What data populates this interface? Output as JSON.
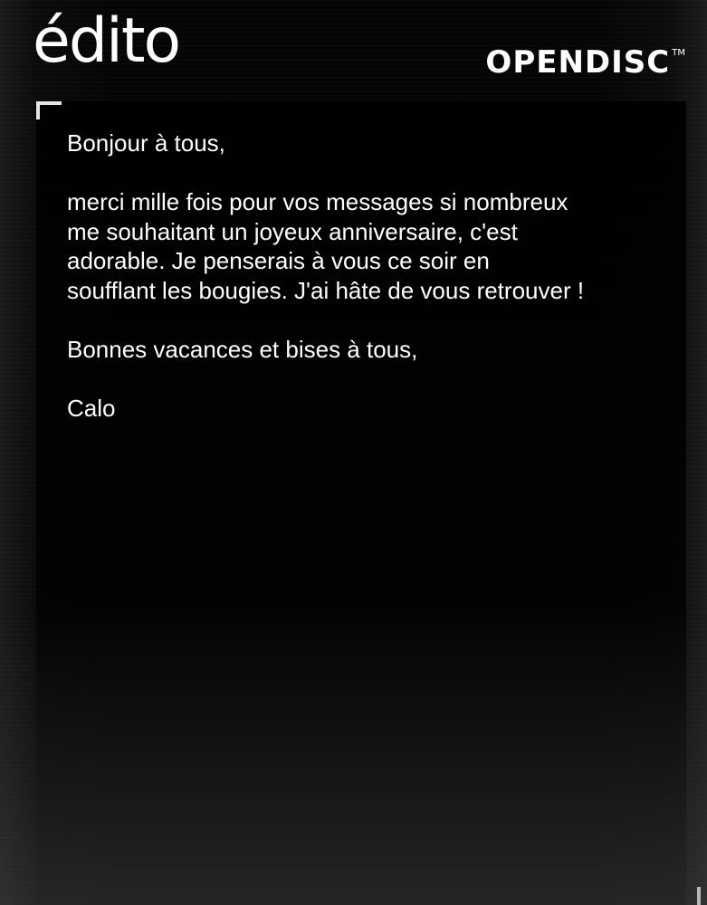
{
  "header": {
    "title": "édito",
    "brand": "OPENDISC",
    "brand_tm": "TM"
  },
  "message": {
    "greeting": "Bonjour à tous,",
    "body_lines": [
      "merci mille fois pour vos messages si nombreux",
      "me souhaitant un joyeux anniversaire, c'est",
      "adorable. Je penserais à vous ce soir en",
      "soufflant les bougies. J'ai hâte de vous retrouver !"
    ],
    "closing": "Bonnes vacances et bises à tous,",
    "signature": "Calo"
  },
  "colors": {
    "background": "#060606",
    "text": "#ffffff"
  }
}
